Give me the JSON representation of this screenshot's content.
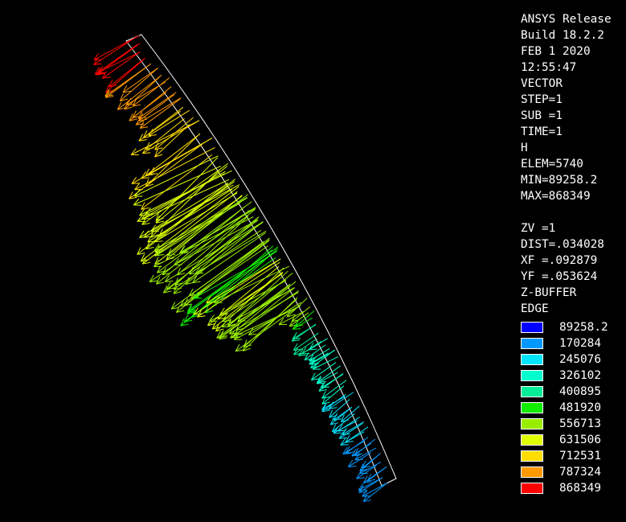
{
  "header": {
    "release": "ANSYS Release",
    "build": "Build 18.2.2",
    "date": "FEB  1 2020",
    "time": "12:55:47"
  },
  "plot_info": {
    "type": "VECTOR",
    "step": "STEP=1",
    "sub": "SUB =1",
    "time": "TIME=1",
    "quantity": "H",
    "elem": "ELEM=5740",
    "min": "MIN=89258.2",
    "max": "MAX=868349"
  },
  "view": {
    "zv": "ZV  =1",
    "dist": "DIST=.034028",
    "xf": "XF  =.092879",
    "yf": "YF  =.053624",
    "zbuffer": "Z-BUFFER",
    "edge": "EDGE"
  },
  "legend": [
    {
      "value": "89258.2",
      "color": "#0000ff"
    },
    {
      "value": "170284",
      "color": "#0099ff"
    },
    {
      "value": "245076",
      "color": "#00e5ff"
    },
    {
      "value": "326102",
      "color": "#00ffcc"
    },
    {
      "value": "400895",
      "color": "#00ee99"
    },
    {
      "value": "481920",
      "color": "#11ee00"
    },
    {
      "value": "556713",
      "color": "#99ee00"
    },
    {
      "value": "631506",
      "color": "#ddff00"
    },
    {
      "value": "712531",
      "color": "#ffdd00"
    },
    {
      "value": "787324",
      "color": "#ff9900"
    },
    {
      "value": "868349",
      "color": "#ff0000"
    }
  ]
}
